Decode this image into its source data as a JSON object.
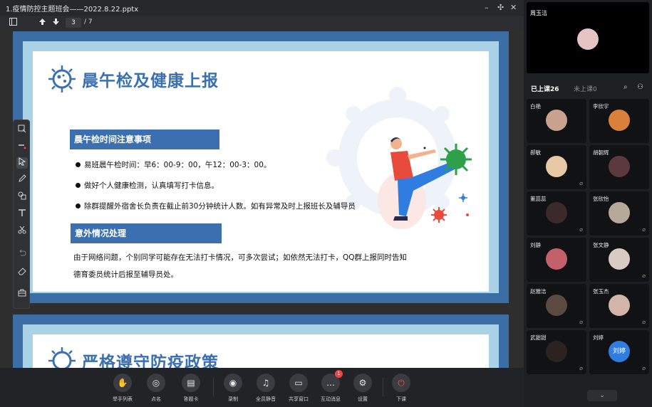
{
  "window": {
    "title": "1.疫情防控主题班会——2022.8.22.pptx",
    "controls": [
      "–",
      "✣",
      "✕"
    ]
  },
  "toolbar": {
    "page_current": "3",
    "page_total": "/ 7"
  },
  "slide1": {
    "title": "晨午检及健康上报",
    "section1": "晨午检时间注意事项",
    "bullets": [
      "易班晨午检时间：早6：00-9：00，午12：00-3：00。",
      "做好个人健康检测，认真填写打卡信息。",
      "除群提醒外宿舍长负责在截止前30分钟统计人数。如有异常及时上报班长及辅导员"
    ],
    "section2": "意外情况处理",
    "para_line1": "由于网络问题，个别同学可能存在无法打卡情况，可多次尝试；如依然无法打卡，QQ群上报同时告知",
    "para_line2": "德育委员统计后报至辅导员处。"
  },
  "slide2": {
    "title": "严格遵守防疫政策"
  },
  "tools": [
    "select-icon",
    "laser-icon",
    "pointer-icon",
    "pen-icon",
    "shapes-icon",
    "text-icon",
    "scissors-icon",
    "undo-icon",
    "eraser-icon",
    "toolbox-icon"
  ],
  "bottom": [
    {
      "label": "举手列表",
      "icon": "hand-icon"
    },
    {
      "label": "点名",
      "icon": "rollcall-icon"
    },
    {
      "label": "答题卡",
      "icon": "answer-card-icon"
    },
    {
      "label": "录制",
      "icon": "record-icon"
    },
    {
      "label": "全员静音",
      "icon": "mute-all-icon"
    },
    {
      "label": "共享窗口",
      "icon": "share-window-icon"
    },
    {
      "label": "互动消息",
      "icon": "message-icon",
      "badge": "1"
    },
    {
      "label": "设置",
      "icon": "settings-icon"
    },
    {
      "label": "下课",
      "icon": "power-icon",
      "color": "#e5573f"
    }
  ],
  "panel": {
    "teacher_name": "周玉洁",
    "tab_joined": "已上课26",
    "tab_not_joined": "未上课0",
    "students": [
      {
        "name": "白艳",
        "color": "#c9a28f"
      },
      {
        "name": "李欣宇",
        "color": "#d9813a"
      },
      {
        "name": "郝敏",
        "color": "#e8c9a6"
      },
      {
        "name": "胡朝辉",
        "color": "#5a3a3f"
      },
      {
        "name": "董蕊蕊",
        "color": "#3a2a2a"
      },
      {
        "name": "张欣怡",
        "color": "#b7a99a"
      },
      {
        "name": "刘静",
        "color": "#c4606a"
      },
      {
        "name": "张文静",
        "color": "#d7cbc4"
      },
      {
        "name": "赵雅洁",
        "color": "#5b4a42"
      },
      {
        "name": "张玉杰",
        "color": "#d2b5a8"
      },
      {
        "name": "武甜甜",
        "color": "#2c2220"
      },
      {
        "name": "刘婷",
        "color": "#2f7de1",
        "initials": "刘婷"
      }
    ]
  }
}
